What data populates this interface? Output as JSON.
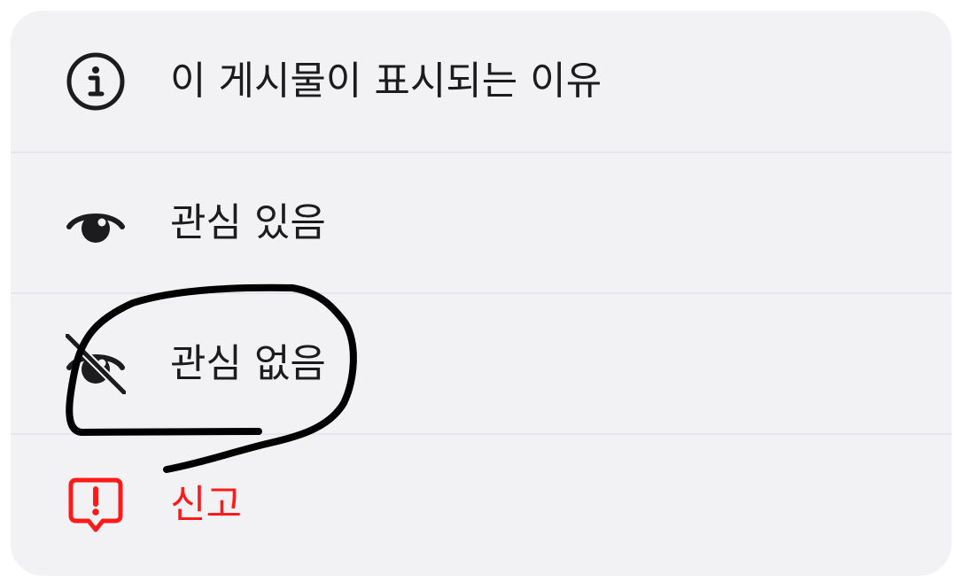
{
  "menu": {
    "items": [
      {
        "label": "이 게시물이 표시되는 이유",
        "icon": "info-circle-icon"
      },
      {
        "label": "관심 있음",
        "icon": "eye-icon"
      },
      {
        "label": "관심 없음",
        "icon": "eye-slash-icon"
      },
      {
        "label": "신고",
        "icon": "report-alert-icon"
      }
    ]
  },
  "colors": {
    "card_background": "#f2f2f4",
    "text": "#1c1c1e",
    "danger": "#ff1a1a",
    "divider": "#e6e6ea",
    "annotation_stroke": "#000000"
  }
}
